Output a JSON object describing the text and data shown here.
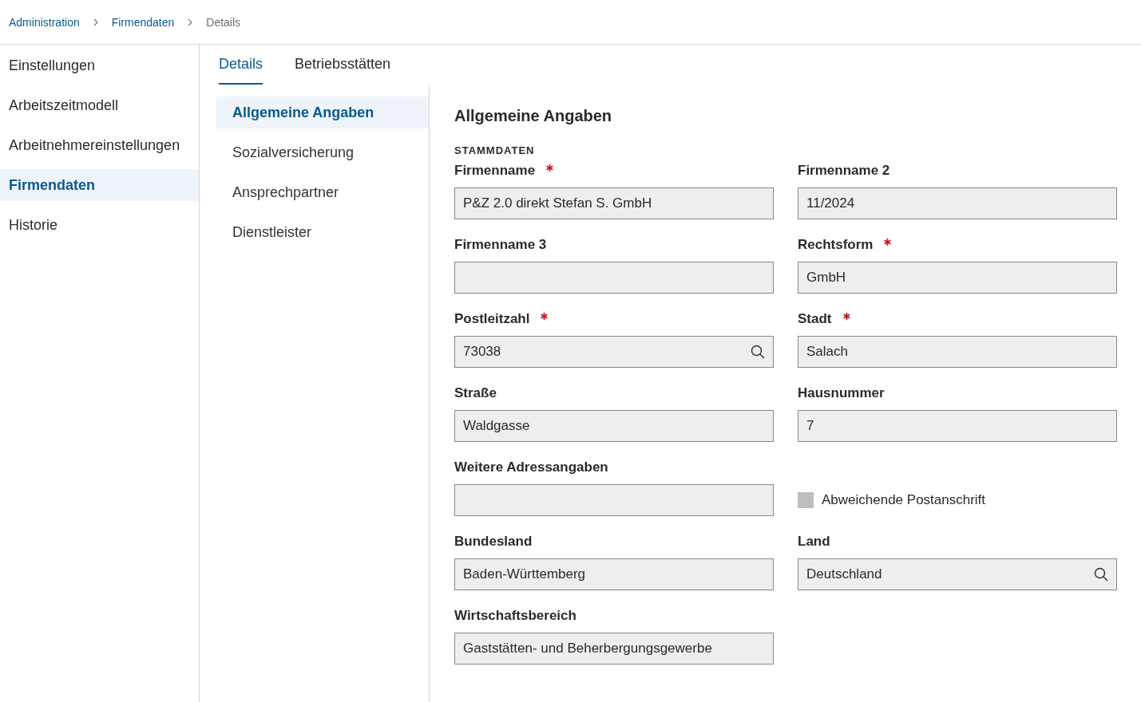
{
  "breadcrumb": [
    {
      "label": "Administration",
      "current": false
    },
    {
      "label": "Firmendaten",
      "current": false
    },
    {
      "label": "Details",
      "current": true
    }
  ],
  "sidebar": {
    "items": [
      {
        "label": "Einstellungen",
        "selected": false
      },
      {
        "label": "Arbeitszeitmodell",
        "selected": false
      },
      {
        "label": "Arbeitnehmereinstellungen",
        "selected": false
      },
      {
        "label": "Firmendaten",
        "selected": true
      },
      {
        "label": "Historie",
        "selected": false
      }
    ]
  },
  "tabs": [
    {
      "label": "Details",
      "selected": true
    },
    {
      "label": "Betriebsstätten",
      "selected": false
    }
  ],
  "subnav": {
    "items": [
      {
        "label": "Allgemeine Angaben",
        "selected": true
      },
      {
        "label": "Sozialversicherung",
        "selected": false
      },
      {
        "label": "Ansprechpartner",
        "selected": false
      },
      {
        "label": "Dienstleister",
        "selected": false
      }
    ]
  },
  "form": {
    "title": "Allgemeine Angaben",
    "section": "STAMMDATEN",
    "fields": [
      {
        "kind": "field",
        "label": "Firmenname",
        "required": true,
        "value": "P&Z 2.0 direkt Stefan S. GmbH"
      },
      {
        "kind": "field",
        "label": "Firmenname 2",
        "required": false,
        "value": "11/2024"
      },
      {
        "kind": "field",
        "label": "Firmenname 3",
        "required": false
      },
      {
        "kind": "field",
        "label": "Rechtsform",
        "required": true,
        "value": "GmbH"
      },
      {
        "kind": "search",
        "label": "Postleitzahl",
        "required": true,
        "value": "73038"
      },
      {
        "kind": "field",
        "label": "Stadt",
        "required": true,
        "value": "Salach"
      },
      {
        "kind": "field",
        "label": "Straße",
        "required": false,
        "value": "Waldgasse"
      },
      {
        "kind": "field",
        "label": "Hausnummer",
        "required": false,
        "value": "7"
      },
      {
        "kind": "field",
        "label": "Weitere Adressangaben",
        "required": false
      },
      {
        "kind": "checkbox",
        "label": "Abweichende Postanschrift",
        "checked": false
      },
      {
        "kind": "field",
        "label": "Bundesland",
        "required": false,
        "value": "Baden-Württemberg"
      },
      {
        "kind": "search",
        "label": "Land",
        "required": false,
        "value": "Deutschland"
      },
      {
        "kind": "field",
        "label": "Wirtschaftsbereich",
        "required": false,
        "value": "Gaststätten- und Beherbergungsgewerbe"
      }
    ]
  }
}
